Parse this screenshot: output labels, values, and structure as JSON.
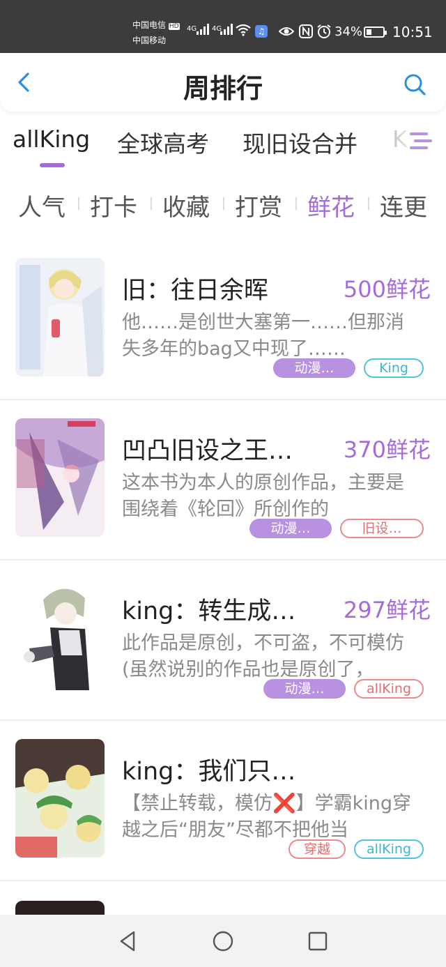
{
  "status_bar": {
    "carrier_1": "中国电信",
    "carrier_1_badge": "HD",
    "carrier_2": "中国移动",
    "network_1": "4G",
    "network_2": "4G",
    "battery_percent": "34%",
    "battery_level": 0.34,
    "time": "10:51",
    "icons": [
      "signal-icon",
      "wifi-icon",
      "music-app-icon",
      "eye-icon",
      "nfc-icon",
      "alarm-icon",
      "battery-icon"
    ]
  },
  "header": {
    "title": "周排行",
    "back_icon": "chevron-left-icon",
    "search_icon": "search-icon"
  },
  "category_tabs": {
    "items": [
      "allKing",
      "全球高考",
      "现旧设合并",
      "K"
    ],
    "active_index": 0,
    "menu_icon": "menu-icon"
  },
  "sort_tabs": {
    "items": [
      "人气",
      "打卡",
      "收藏",
      "打赏",
      "鲜花",
      "连更"
    ],
    "active_index": 4
  },
  "colors": {
    "accent": "#a56cd9",
    "tag_fill": "#b891e0",
    "tag_blue": "#4cc3e0",
    "tag_red": "#ea8a8a",
    "status_bar": "#3c3c3c"
  },
  "list": [
    {
      "title": "旧：往日余晖",
      "score": "500鲜花",
      "desc": "他……是创世大塞第一……但那消失多年的bag又中现了……",
      "tags": [
        {
          "label": "动漫…",
          "style": "fill"
        },
        {
          "label": "King",
          "style": "blue"
        }
      ]
    },
    {
      "title": "凹凸旧设之王…",
      "score": "370鲜花",
      "desc": "这本书为本人的原创作品，主要是围绕着《轮回》所创作的",
      "tags": [
        {
          "label": "动漫…",
          "style": "fill"
        },
        {
          "label": "旧设…",
          "style": "red"
        }
      ]
    },
    {
      "title": "king：转生成…",
      "score": "297鲜花",
      "desc": "此作品是原创，不可盗，不可模仿(虽然说别的作品也是原创了，",
      "tags": [
        {
          "label": "动漫…",
          "style": "fill"
        },
        {
          "label": "allKing",
          "style": "red"
        }
      ]
    },
    {
      "title": "king：我们只…",
      "score": "",
      "desc": "【禁止转载，模仿❌】学霸king穿越之后“朋友”尽都不把他当",
      "tags": [
        {
          "label": "穿越",
          "style": "red"
        },
        {
          "label": "allKing",
          "style": "blue"
        }
      ]
    }
  ],
  "nav_bar": {
    "icons": [
      "back-triangle-icon",
      "home-circle-icon",
      "recents-square-icon"
    ]
  }
}
